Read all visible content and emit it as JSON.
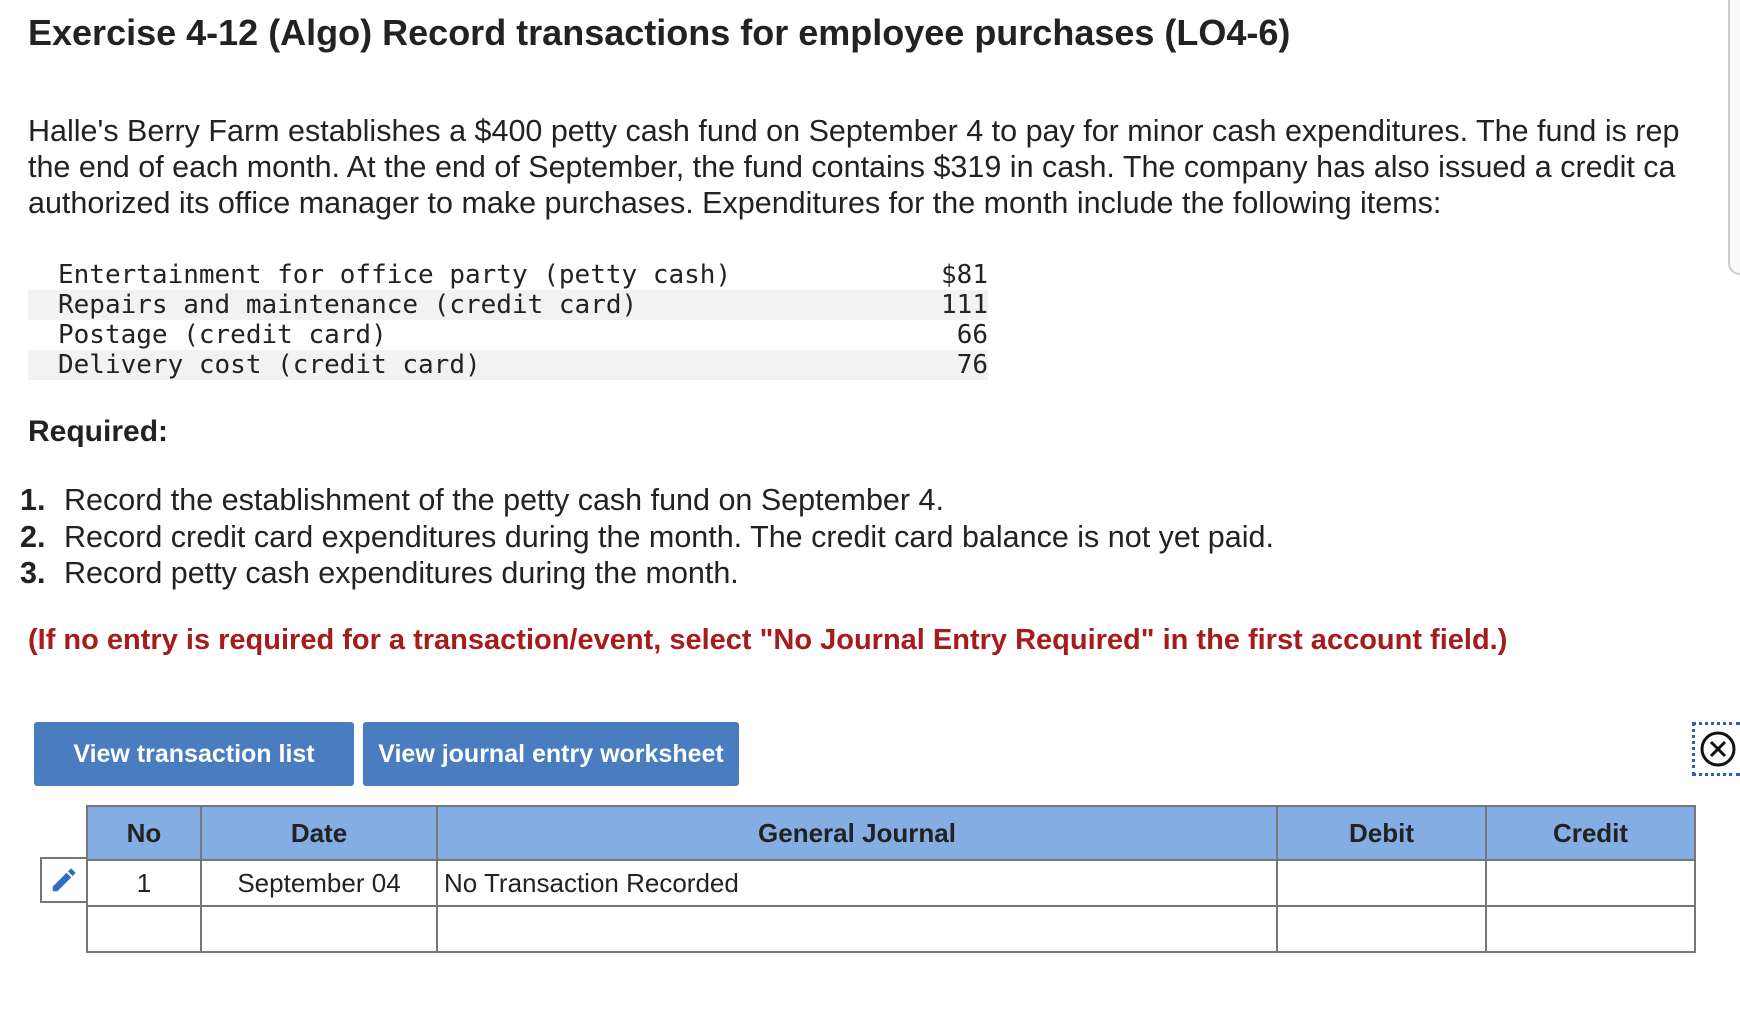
{
  "title": "Exercise 4-12 (Algo) Record transactions for employee purchases (LO4-6)",
  "intro": {
    "line1": "Halle's Berry Farm establishes a $400 petty cash fund on September 4 to pay for minor cash expenditures. The fund is rep",
    "line2": "the end of each month. At the end of September, the fund contains $319 in cash. The company has also issued a credit ca",
    "line3": "authorized its office manager to make purchases. Expenditures for the month include the following items:"
  },
  "expenditures": [
    {
      "desc": "Entertainment for office party (petty cash)",
      "amount": "$81"
    },
    {
      "desc": "Repairs and maintenance (credit card)",
      "amount": "111"
    },
    {
      "desc": "Postage (credit card)",
      "amount": "66"
    },
    {
      "desc": "Delivery cost (credit card)",
      "amount": "76"
    }
  ],
  "required": {
    "heading": "Required:",
    "steps": [
      {
        "num": "1.",
        "text": "Record the establishment of the petty cash fund on September 4."
      },
      {
        "num": "2.",
        "text": "Record credit card expenditures during the month. The credit card balance is not yet paid."
      },
      {
        "num": "3.",
        "text": "Record petty cash expenditures during the month."
      }
    ],
    "instruction": "(If no entry is required for a transaction/event, select \"No Journal Entry Required\" in the first account field.)"
  },
  "buttons": {
    "transaction_list": "View transaction list",
    "journal_worksheet": "View journal entry worksheet"
  },
  "journal": {
    "headers": {
      "no": "No",
      "date": "Date",
      "general_journal": "General Journal",
      "debit": "Debit",
      "credit": "Credit"
    },
    "rows": [
      {
        "no": "1",
        "date": "September 04",
        "account": "No Transaction Recorded",
        "debit": "",
        "credit": ""
      },
      {
        "no": "",
        "date": "",
        "account": "",
        "debit": "",
        "credit": ""
      }
    ]
  },
  "icons": {
    "edit": "pencil-icon",
    "close": "close-circle-icon"
  },
  "colors": {
    "button_bg": "#4a7cc0",
    "table_header_bg": "#84aee3",
    "instruction_text": "#a61c1c",
    "focus_outline": "#2f5fb3"
  }
}
